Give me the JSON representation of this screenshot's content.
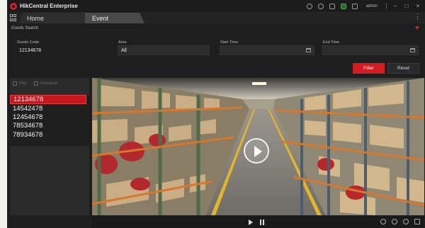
{
  "app": {
    "title": "HikCentral Enterprise"
  },
  "titlebar": {
    "user": "admin",
    "icons": [
      "bell-icon",
      "globe-icon",
      "alarm-icon",
      "green-status-icon",
      "layout-icon",
      "user-icon"
    ],
    "window_controls": {
      "minimize": "–",
      "maximize": "□",
      "close": "×"
    }
  },
  "tabs": [
    {
      "label": "Home",
      "active": false
    },
    {
      "label": "Event",
      "active": true
    }
  ],
  "tab_more": "⋮",
  "filter": {
    "section_title": "Goods Search",
    "fields": {
      "goods_code": {
        "label": "Goods Code",
        "value": "12134678"
      },
      "area": {
        "label": "Area",
        "value": "All"
      },
      "start_time": {
        "label": "Start Time",
        "value": ""
      },
      "end_time": {
        "label": "End Time",
        "value": ""
      }
    },
    "filter_button": "Filter",
    "reset_button": "Reset",
    "accent_color": "#d51c22"
  },
  "left_panel": {
    "toolbar": {
      "play_label": "Play",
      "download_label": "Download"
    },
    "items": [
      {
        "label": "12134678",
        "selected": true
      },
      {
        "label": "14542478",
        "selected": false
      },
      {
        "label": "12454678",
        "selected": false
      },
      {
        "label": "78534678",
        "selected": false
      },
      {
        "label": "78934678",
        "selected": false
      }
    ]
  },
  "playback": {
    "controls": [
      "play-icon",
      "pause-icon"
    ],
    "right_icons": [
      "screenshot-icon",
      "record-icon",
      "volume-icon",
      "fullscreen-icon"
    ]
  }
}
